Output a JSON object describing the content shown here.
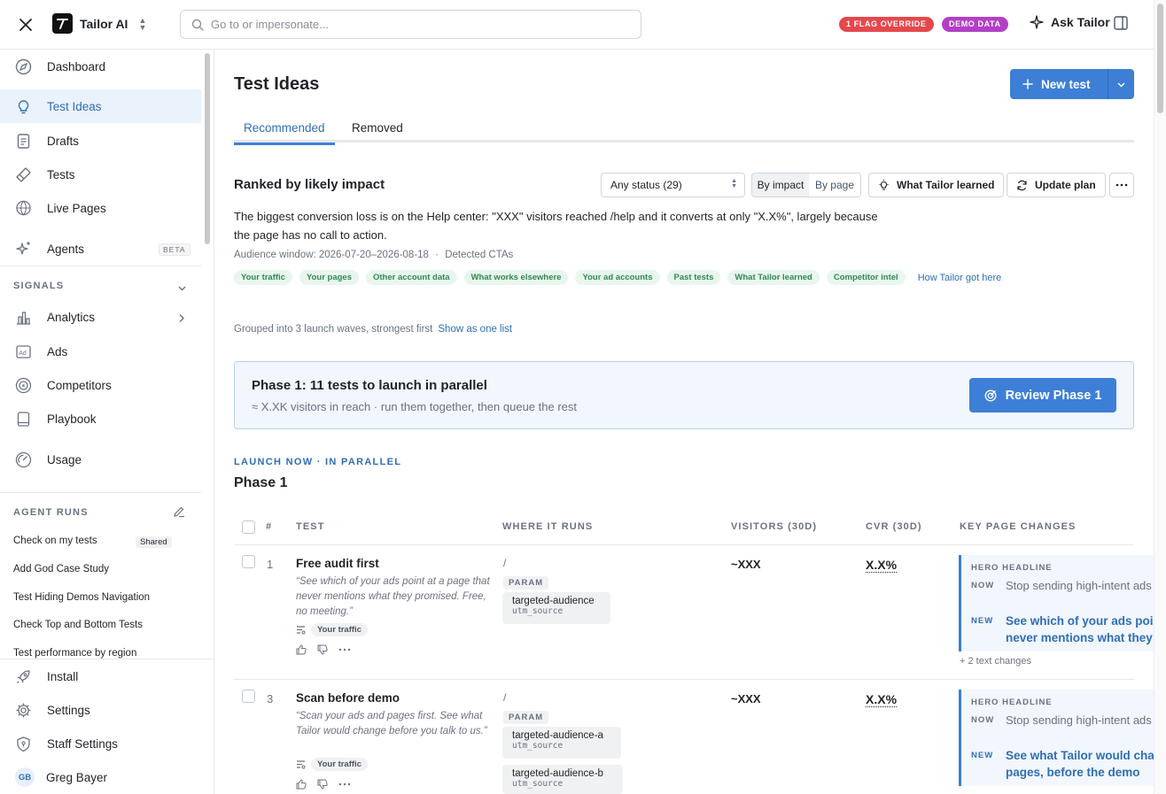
{
  "topbar": {
    "app_name": "Tailor AI",
    "search_placeholder": "Go to or impersonate...",
    "flag_badge": "1 FLAG OVERRIDE",
    "demo_badge": "DEMO DATA",
    "ask_label": "Ask Tailor",
    "colors": {
      "flag": "#e5484d",
      "demo": "#b33fc6",
      "accent": "#3d7fd6"
    }
  },
  "sidebar": {
    "nav": [
      {
        "label": "Dashboard",
        "icon": "dashboard-icon"
      },
      {
        "label": "Test Ideas",
        "icon": "lightbulb-icon",
        "active": true
      },
      {
        "label": "Drafts",
        "icon": "document-icon"
      },
      {
        "label": "Tests",
        "icon": "flask-icon"
      },
      {
        "label": "Live Pages",
        "icon": "globe-www-icon"
      },
      {
        "label": "Agents",
        "icon": "sparkle-icon",
        "badge": "BETA"
      }
    ],
    "signals_label": "SIGNALS",
    "signals": [
      {
        "label": "Analytics",
        "icon": "bar-chart-icon"
      },
      {
        "label": "Ads",
        "icon": "ad-icon"
      },
      {
        "label": "Competitors",
        "icon": "radar-icon"
      },
      {
        "label": "Playbook",
        "icon": "book-icon"
      },
      {
        "label": "Usage",
        "icon": "gauge-icon"
      }
    ],
    "agent_runs_label": "AGENT RUNS",
    "agent_runs": [
      {
        "label": "Check on my tests",
        "badge": "Shared"
      },
      {
        "label": "Add God Case Study"
      },
      {
        "label": "Test Hiding Demos Navigation"
      },
      {
        "label": "Check Top and Bottom Tests"
      },
      {
        "label": "Test performance by region"
      }
    ],
    "bottom": [
      {
        "label": "Install",
        "icon": "rocket-icon"
      },
      {
        "label": "Settings",
        "icon": "gear-icon"
      },
      {
        "label": "Staff Settings",
        "icon": "shield-icon"
      }
    ],
    "user": {
      "initials": "GB",
      "name": "Greg Bayer"
    }
  },
  "main": {
    "title": "Test Ideas",
    "new_test_label": "New test",
    "tabs": [
      {
        "label": "Recommended",
        "active": true
      },
      {
        "label": "Removed"
      }
    ],
    "ranked_title": "Ranked by likely impact",
    "status_select": "Any status (29)",
    "sort": {
      "on": "By impact",
      "off": "By page"
    },
    "learned_button": "What Tailor learned",
    "update_button": "Update plan",
    "summary": "The biggest conversion loss is on the Help center: \"XXX\" visitors reached /help and it converts at only \"X.X%\", largely because the page has no call to action.",
    "meta_window": "Audience window: 2026-07-20–2026-08-18",
    "meta_sep": "·",
    "meta_ctas": "Detected CTAs",
    "sources": [
      "Your traffic",
      "Your pages",
      "Other account data",
      "What works elsewhere",
      "Your ad accounts",
      "Past tests",
      "What Tailor learned",
      "Competitor intel"
    ],
    "how_link": "How Tailor got here",
    "grouped_text": "Grouped into 3 launch waves, strongest first",
    "grouped_link": "Show as one list",
    "phase_banner": {
      "title": "Phase 1: 11 tests to launch in parallel",
      "subtitle": "≈ X.XK visitors in reach · run them together, then queue the rest",
      "button": "Review Phase 1"
    },
    "launch_label": "LAUNCH NOW · IN PARALLEL",
    "phase_heading": "Phase 1",
    "columns": {
      "num": "#",
      "test": "TEST",
      "where": "WHERE IT RUNS",
      "visitors": "VISITORS (30D)",
      "cvr": "CVR (30D)",
      "changes": "KEY PAGE CHANGES"
    },
    "rows": [
      {
        "num": "1",
        "name": "Free audit first",
        "desc": "“See which of your ads point at a page that never mentions what they promised. Free, no meeting.”",
        "source": "Your traffic",
        "path": "/",
        "param": "PARAM",
        "audiences": [
          {
            "name": "targeted-audience",
            "key": "utm_source"
          }
        ],
        "visitors": "~XXX",
        "cvr": "X.X%",
        "change": {
          "label": "HERO HEADLINE",
          "now_label": "NOW",
          "now": "Stop sending high-intent ads to generic pages.",
          "new_label": "NEW",
          "new": "See which of your ads point at a page that never mentions what they promised"
        },
        "more": "+ 2 text changes"
      },
      {
        "num": "3",
        "name": "Scan before demo",
        "desc": "“Scan your ads and pages first. See what Tailor would change before you talk to us.”",
        "source": "Your traffic",
        "path": "/",
        "param": "PARAM",
        "audiences": [
          {
            "name": "targeted-audience-a",
            "key": "utm_source"
          },
          {
            "name": "targeted-audience-b",
            "key": "utm_source"
          }
        ],
        "visitors": "~XXX",
        "cvr": "X.X%",
        "change": {
          "label": "HERO HEADLINE",
          "now_label": "NOW",
          "now": "Stop sending high-intent ads to generic pages.",
          "new_label": "NEW",
          "new": "See what Tailor would change on your ads and pages, before the demo"
        }
      }
    ]
  }
}
